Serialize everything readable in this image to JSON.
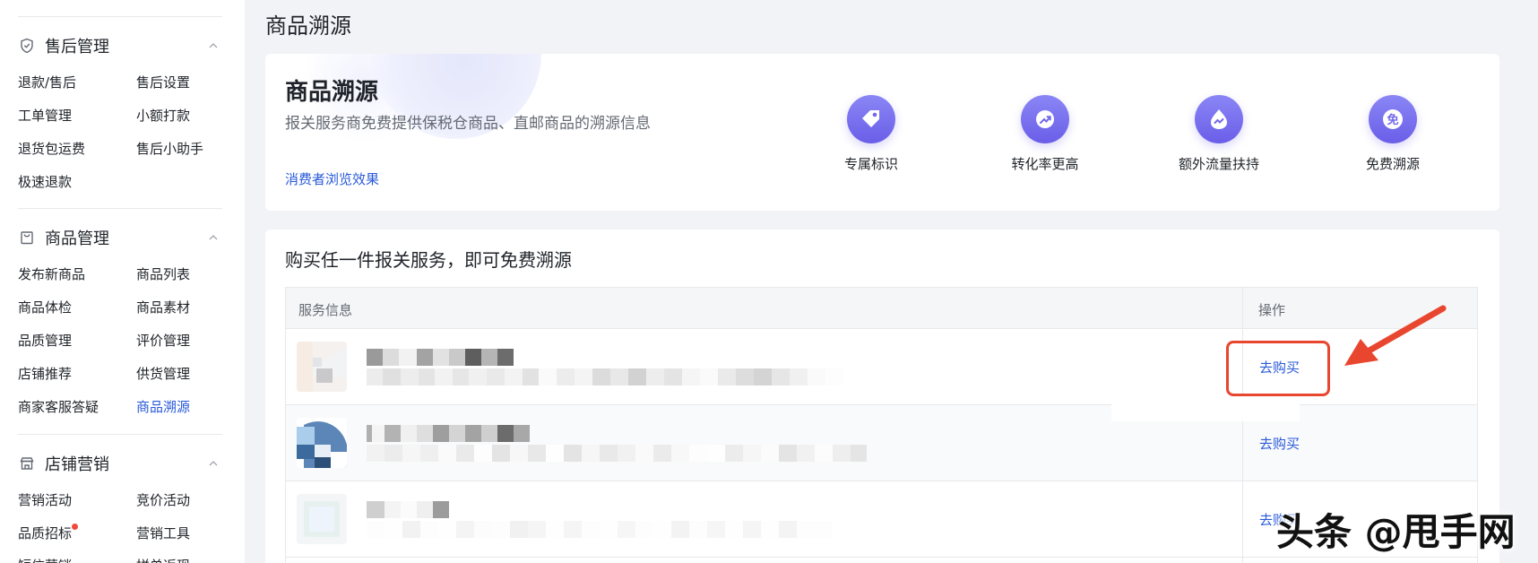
{
  "sidebar": {
    "sections": [
      {
        "title": "售后管理",
        "icon": "shield-icon",
        "items": [
          {
            "label": "退款/售后",
            "active": false
          },
          {
            "label": "售后设置",
            "active": false
          },
          {
            "label": "工单管理",
            "active": false
          },
          {
            "label": "小额打款",
            "active": false
          },
          {
            "label": "退货包运费",
            "active": false
          },
          {
            "label": "售后小助手",
            "active": false
          },
          {
            "label": "极速退款",
            "active": false
          }
        ]
      },
      {
        "title": "商品管理",
        "icon": "bag-icon",
        "items": [
          {
            "label": "发布新商品",
            "active": false
          },
          {
            "label": "商品列表",
            "active": false
          },
          {
            "label": "商品体检",
            "active": false
          },
          {
            "label": "商品素材",
            "active": false
          },
          {
            "label": "品质管理",
            "active": false
          },
          {
            "label": "评价管理",
            "active": false
          },
          {
            "label": "店铺推荐",
            "active": false
          },
          {
            "label": "供货管理",
            "active": false
          },
          {
            "label": "商家客服答疑",
            "active": false
          },
          {
            "label": "商品溯源",
            "active": true
          }
        ]
      },
      {
        "title": "店铺营销",
        "icon": "shop-icon",
        "items": [
          {
            "label": "营销活动",
            "active": false
          },
          {
            "label": "竞价活动",
            "active": false
          },
          {
            "label": "品质招标",
            "active": false
          },
          {
            "label": "营销工具",
            "active": false
          },
          {
            "label": "短信营销",
            "active": false
          },
          {
            "label": "拼单返现",
            "active": false
          }
        ]
      }
    ]
  },
  "page": {
    "title": "商品溯源"
  },
  "banner": {
    "title": "商品溯源",
    "description": "报关服务商免费提供保税仓商品、直邮商品的溯源信息",
    "link": "消费者浏览效果",
    "features": [
      {
        "label": "专属标识",
        "icon": "tag-icon"
      },
      {
        "label": "转化率更高",
        "icon": "trend-up-icon"
      },
      {
        "label": "额外流量扶持",
        "icon": "flow-icon"
      },
      {
        "label": "免费溯源",
        "icon": "free-icon"
      }
    ]
  },
  "services": {
    "title": "购买任一件报关服务，即可免费溯源",
    "columns": [
      "服务信息",
      "操作"
    ],
    "rows": [
      {
        "action": "去购买"
      },
      {
        "action": "去购买"
      },
      {
        "action": "去购买"
      }
    ]
  },
  "watermark": "头条 @甩手网",
  "colors": {
    "accent": "#2a5ad9",
    "feature_gradient_top": "#8a86f5",
    "feature_gradient_bottom": "#6a5ee8",
    "highlight": "#e8462f"
  }
}
